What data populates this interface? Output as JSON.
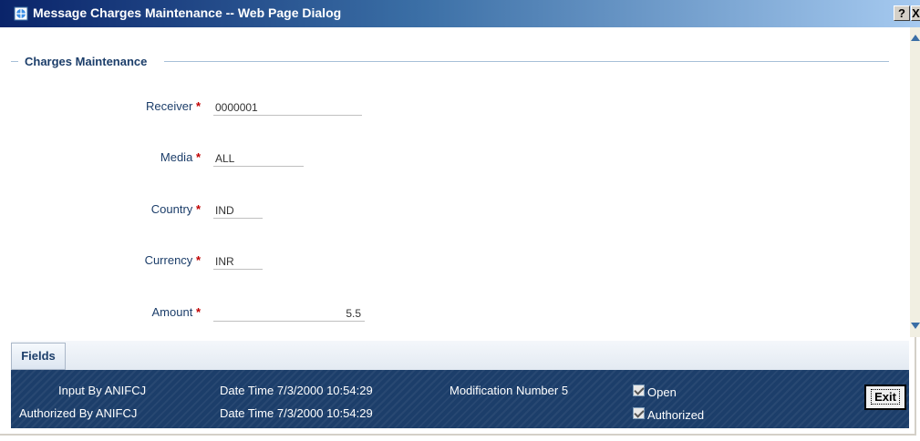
{
  "window": {
    "title": "Message Charges Maintenance -- Web Page Dialog",
    "help_label": "?",
    "close_label": "X"
  },
  "section": {
    "title": "Charges Maintenance"
  },
  "fields": {
    "receiver": {
      "label": "Receiver",
      "required": "*",
      "value": "0000001"
    },
    "media": {
      "label": "Media",
      "required": "*",
      "value": "ALL"
    },
    "country": {
      "label": "Country",
      "required": "*",
      "value": "IND"
    },
    "currency": {
      "label": "Currency",
      "required": "*",
      "value": "INR"
    },
    "amount": {
      "label": "Amount",
      "required": "*",
      "value": "5.5"
    }
  },
  "tabs": {
    "fields_label": "Fields"
  },
  "footer": {
    "input_by": "Input By ANIFCJ",
    "authorized_by": "Authorized By ANIFCJ",
    "input_date_time": "Date Time 7/3/2000 10:54:29",
    "auth_date_time": "Date Time 7/3/2000 10:54:29",
    "modification_number": "Modification Number 5",
    "open_label": "Open",
    "open_checked": true,
    "authorized_label": "Authorized",
    "authorized_checked": true,
    "exit_label": "Exit"
  }
}
